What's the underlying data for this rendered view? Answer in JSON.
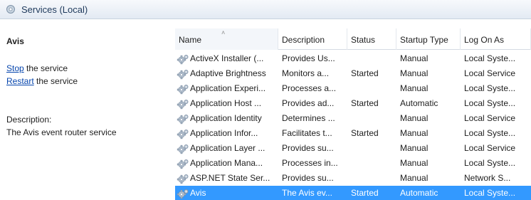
{
  "window": {
    "title": "Services (Local)"
  },
  "left_pane": {
    "service_name": "Avis",
    "stop_link": "Stop",
    "stop_suffix": " the service",
    "restart_link": "Restart",
    "restart_suffix": " the service",
    "description_label": "Description:",
    "description_text": "The Avis event router service"
  },
  "table": {
    "columns": [
      "Name",
      "Description",
      "Status",
      "Startup Type",
      "Log On As"
    ],
    "sorted_column": "Name",
    "rows": [
      {
        "name": "ActiveX Installer (...",
        "description": "Provides Us...",
        "status": "",
        "startup_type": "Manual",
        "log_on_as": "Local Syste..."
      },
      {
        "name": "Adaptive Brightness",
        "description": "Monitors a...",
        "status": "Started",
        "startup_type": "Manual",
        "log_on_as": "Local Service"
      },
      {
        "name": "Application Experi...",
        "description": "Processes a...",
        "status": "",
        "startup_type": "Manual",
        "log_on_as": "Local Syste..."
      },
      {
        "name": "Application Host ...",
        "description": "Provides ad...",
        "status": "Started",
        "startup_type": "Automatic",
        "log_on_as": "Local Syste..."
      },
      {
        "name": "Application Identity",
        "description": "Determines ...",
        "status": "",
        "startup_type": "Manual",
        "log_on_as": "Local Service"
      },
      {
        "name": "Application Infor...",
        "description": "Facilitates t...",
        "status": "Started",
        "startup_type": "Manual",
        "log_on_as": "Local Syste..."
      },
      {
        "name": "Application Layer ...",
        "description": "Provides su...",
        "status": "",
        "startup_type": "Manual",
        "log_on_as": "Local Service"
      },
      {
        "name": "Application Mana...",
        "description": "Processes in...",
        "status": "",
        "startup_type": "Manual",
        "log_on_as": "Local Syste..."
      },
      {
        "name": "ASP.NET State Ser...",
        "description": "Provides su...",
        "status": "",
        "startup_type": "Manual",
        "log_on_as": "Network S..."
      },
      {
        "name": "Avis",
        "description": "The Avis ev...",
        "status": "Started",
        "startup_type": "Automatic",
        "log_on_as": "Local Syste..."
      }
    ],
    "selected_row": "Avis"
  },
  "colors": {
    "selection": "#3399ff",
    "link": "#0645ad"
  },
  "icons": {
    "window": "services-icon",
    "row": "gear-icon"
  }
}
